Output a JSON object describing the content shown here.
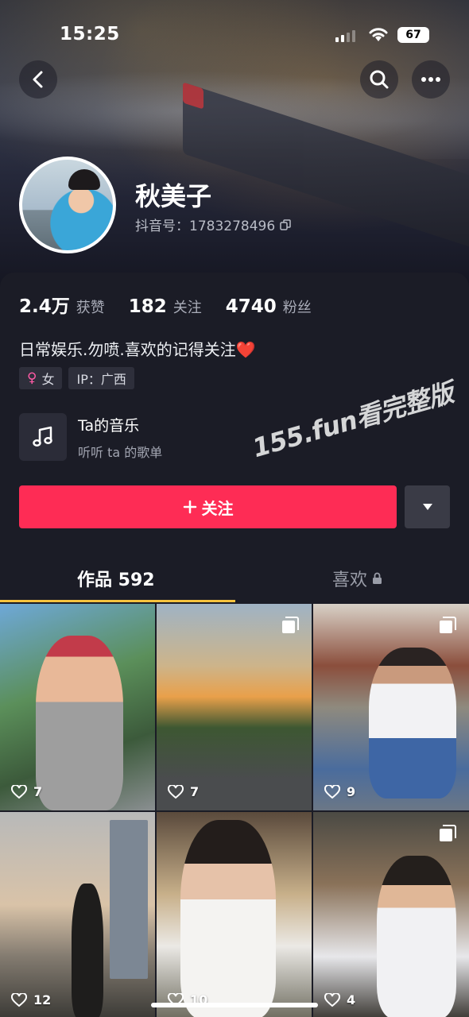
{
  "status_bar": {
    "time": "15:25",
    "battery": "67"
  },
  "profile": {
    "name": "秋美子",
    "douyin_id": "抖音号：1783278496",
    "stats": [
      {
        "value": "2.4万",
        "label": "获赞"
      },
      {
        "value": "182",
        "label": "关注"
      },
      {
        "value": "4740",
        "label": "粉丝"
      }
    ],
    "bio": "日常娱乐.勿喷.喜欢的记得关注❤️",
    "tags": {
      "gender": "女",
      "ip": "IP：广西"
    }
  },
  "music": {
    "title": "Ta的音乐",
    "subtitle": "听听 ta 的歌单"
  },
  "watermark": "155.fun看完整版",
  "actions": {
    "follow_label": "关注"
  },
  "tabs": {
    "works": "作品 592",
    "likes": "喜欢"
  },
  "grid": [
    {
      "likes": "7",
      "multi": false
    },
    {
      "likes": "7",
      "multi": true
    },
    {
      "likes": "9",
      "multi": true
    },
    {
      "likes": "12",
      "multi": false
    },
    {
      "likes": "10",
      "multi": false
    },
    {
      "likes": "4",
      "multi": true
    }
  ],
  "colors": {
    "accent": "#fe2c55",
    "tab_underline": "#f7c33e",
    "background": "#1b1c26"
  }
}
